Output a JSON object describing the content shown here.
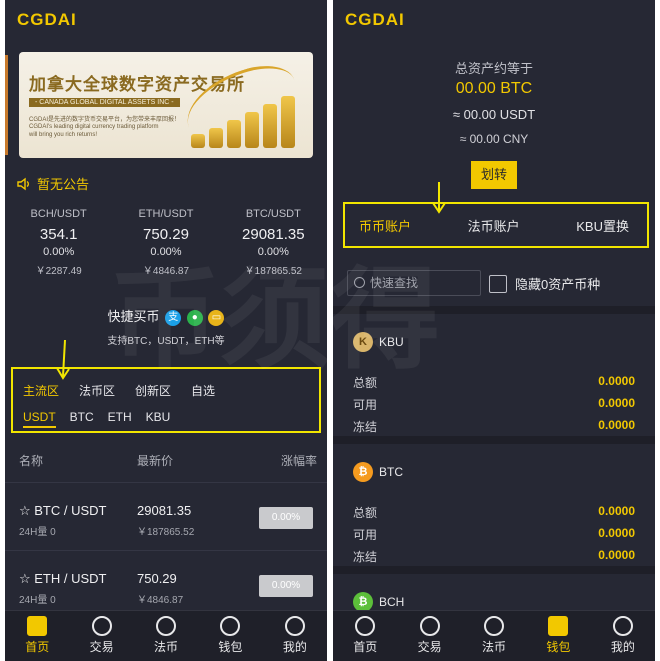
{
  "left": {
    "logo": "CGDAI",
    "banner": {
      "title": "加拿大全球数字资产交易所",
      "subtitle": "- CANADA GLOBAL DIGITAL ASSETS INC -",
      "line1": "CGDAI是先进的数字货币交易平台，为您带来丰厚回报！",
      "line2": "CGDAI's leading digital currency trading platform",
      "line3": "will bring you rich returns!"
    },
    "notice": "暂无公告",
    "tickers": [
      {
        "pair": "BCH/USDT",
        "price": "354.1",
        "change": "0.00%",
        "cny": "￥2287.49"
      },
      {
        "pair": "ETH/USDT",
        "price": "750.29",
        "change": "0.00%",
        "cny": "￥4846.87"
      },
      {
        "pair": "BTC/USDT",
        "price": "29081.35",
        "change": "0.00%",
        "cny": "￥187865.52"
      }
    ],
    "quick_buy": "快捷买币",
    "quick_sub": "支持BTC，USDT，ETH等",
    "zone_tabs": [
      "主流区",
      "法币区",
      "创新区",
      "自选"
    ],
    "coin_tabs": [
      "USDT",
      "BTC",
      "ETH",
      "KBU"
    ],
    "table_headers": {
      "name": "名称",
      "latest": "最新价",
      "change": "涨幅率"
    },
    "rows": [
      {
        "pair": "☆ BTC / USDT",
        "vol": "24H量 0",
        "price": "29081.35",
        "cny": "￥187865.52",
        "change": "0.00%"
      },
      {
        "pair": "☆ ETH / USDT",
        "vol": "24H量 0",
        "price": "750.29",
        "cny": "￥4846.87",
        "change": "0.00%"
      }
    ],
    "tabbar": [
      "首页",
      "交易",
      "法币",
      "钱包",
      "我的"
    ]
  },
  "right": {
    "logo": "CGDAI",
    "total_label": "总资产约等于",
    "total_btc": "00.00 BTC",
    "total_usdt": "≈ 00.00 USDT",
    "total_cny": "≈ 00.00 CNY",
    "transfer": "划转",
    "account_tabs": [
      "币币账户",
      "法币账户",
      "KBU置换"
    ],
    "search_placeholder": "快速查找",
    "hide_zero": "隐藏0资产币种",
    "assets": [
      {
        "coin": "KBU",
        "total_label": "总额",
        "total": "0.0000",
        "avail_label": "可用",
        "avail": "0.0000",
        "frozen_label": "冻结",
        "frozen": "0.0000"
      },
      {
        "coin": "BTC",
        "total_label": "总额",
        "total": "0.0000",
        "avail_label": "可用",
        "avail": "0.0000",
        "frozen_label": "冻结",
        "frozen": "0.0000"
      },
      {
        "coin": "BCH"
      }
    ],
    "tabbar": [
      "首页",
      "交易",
      "法币",
      "钱包",
      "我的"
    ]
  },
  "watermark": "币须得",
  "colors": {
    "accent": "#f2c800",
    "background": "#262834",
    "highlight_box": "#f2e600"
  }
}
